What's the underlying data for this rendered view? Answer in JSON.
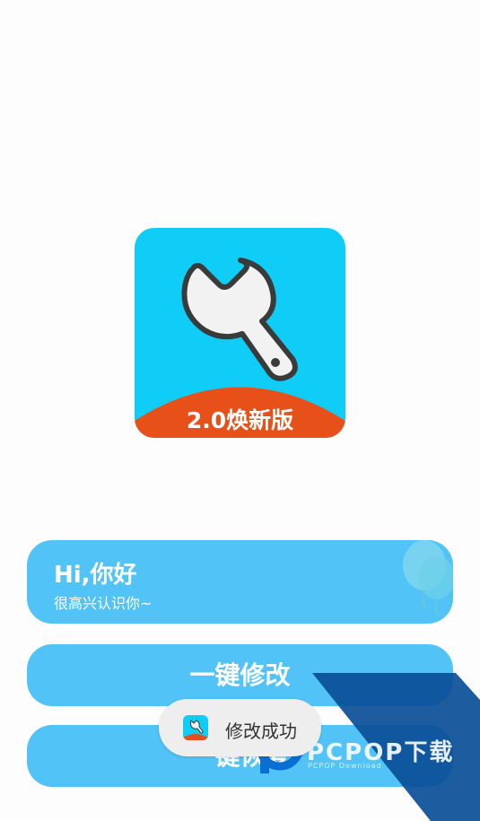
{
  "app_icon": {
    "version_label": "2.0焕新版",
    "icon": "wrench-icon",
    "background_color": "#10cdf7",
    "banner_color": "#e8501a"
  },
  "greeting": {
    "title": "Hi,你好",
    "subtitle": "很高兴认识你~",
    "decoration": "balloon-icon",
    "card_color": "#52c3f7"
  },
  "buttons": {
    "modify_label": "一键修改",
    "restore_label": "一键恢复"
  },
  "toast": {
    "message": "修改成功",
    "icon": "app-logo-icon"
  },
  "watermark": {
    "brand": "PCPOP下载",
    "subtext": "PCPOP Download",
    "color": "#0a4f97"
  }
}
